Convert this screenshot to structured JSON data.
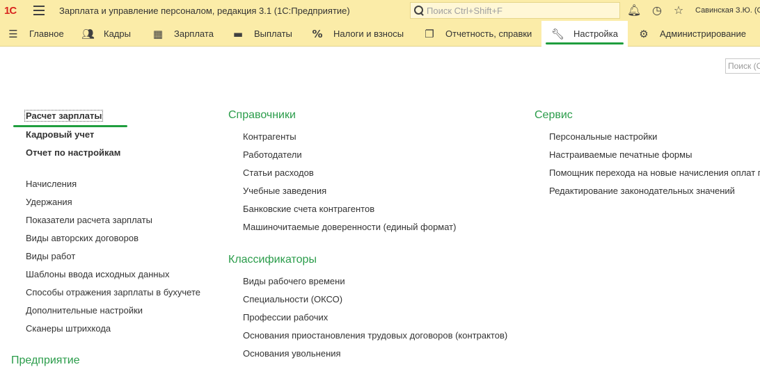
{
  "titlebar": {
    "logo": "1С",
    "title": "Зарплата и управление персоналом, редакция 3.1  (1С:Предприятие)",
    "search_placeholder": "Поиск Ctrl+Shift+F",
    "user": "Савинская З.Ю. (С",
    "icons": [
      "bell-icon",
      "history-icon",
      "star-icon"
    ]
  },
  "sections": [
    {
      "label": "Главное",
      "icon": "menu-lines-icon"
    },
    {
      "label": "Кадры",
      "icon": "people-icon"
    },
    {
      "label": "Зарплата",
      "icon": "calculator-icon"
    },
    {
      "label": "Выплаты",
      "icon": "wallet-icon"
    },
    {
      "label": "Налоги и взносы",
      "icon": "percent-icon"
    },
    {
      "label": "Отчетность, справки",
      "icon": "documents-icon"
    },
    {
      "label": "Настройка",
      "icon": "wrench-icon",
      "active": true
    },
    {
      "label": "Администрирование",
      "icon": "gear-icon"
    }
  ],
  "mini_search_placeholder": "Поиск (С",
  "left": {
    "top_links": [
      "Расчет зарплаты",
      "Кадровый учет",
      "Отчет по настройкам"
    ],
    "links": [
      "Начисления",
      "Удержания",
      "Показатели расчета зарплаты",
      "Виды авторских договоров",
      "Виды работ",
      "Шаблоны ввода исходных данных",
      "Способы отражения зарплаты в бухучете",
      "Дополнительные настройки",
      "Сканеры штрихкода"
    ],
    "group_bottom": "Предприятие"
  },
  "middle": {
    "groups": [
      {
        "title": "Справочники",
        "items": [
          "Контрагенты",
          "Работодатели",
          "Статьи расходов",
          "Учебные заведения",
          "Банковские счета контрагентов",
          "Машиночитаемые доверенности (единый формат)"
        ]
      },
      {
        "title": "Классификаторы",
        "items": [
          "Виды рабочего времени",
          "Специальности (ОКСО)",
          "Профессии рабочих",
          "Основания приостановления трудовых договоров (контрактов)",
          "Основания увольнения"
        ]
      }
    ]
  },
  "right": {
    "title": "Сервис",
    "items": [
      "Персональные настройки",
      "Настраиваемые печатные формы",
      "Помощник перехода на новые начисления оплат п",
      "Редактирование законодательных значений"
    ]
  },
  "colors": {
    "bar_bg": "#fbeca8",
    "accent_green": "#1f9e3e",
    "group_title_green": "#2a9c4a",
    "logo_red": "#d8261f"
  }
}
